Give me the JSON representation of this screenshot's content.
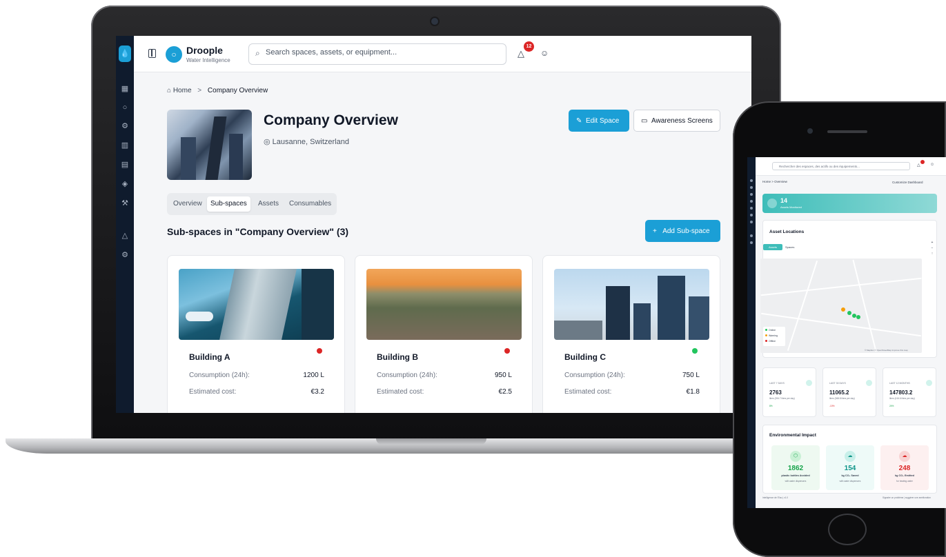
{
  "laptop": {
    "brand": {
      "name": "Droople",
      "tagline": "Water Intelligence"
    },
    "search_placeholder": "Search spaces, assets, or equipment...",
    "notification_count": "12",
    "rail_icons": [
      "droople-logo-icon",
      "dashboard-icon",
      "droplet-icon",
      "gear-icon",
      "map-icon",
      "building-icon",
      "package-icon",
      "wrench-icon",
      "bell-icon",
      "settings-icon"
    ],
    "breadcrumb": {
      "home": "Home",
      "separator": ">",
      "current": "Company Overview"
    },
    "page": {
      "title": "Company Overview",
      "location": "Lausanne, Switzerland"
    },
    "actions": {
      "edit": "Edit Space",
      "awareness": "Awareness Screens",
      "add": "Add Sub-space"
    },
    "tabs": [
      {
        "label": "Overview"
      },
      {
        "label": "Sub-spaces",
        "active": true
      },
      {
        "label": "Assets"
      },
      {
        "label": "Consumables"
      }
    ],
    "section_title": "Sub-spaces in \"Company Overview\" (3)",
    "cards": [
      {
        "name": "Building A",
        "status_color": "#dc2626",
        "consumption_label": "Consumption (24h):",
        "consumption": "1200 L",
        "cost_label": "Estimated cost:",
        "cost": "€3.2"
      },
      {
        "name": "Building B",
        "status_color": "#dc2626",
        "consumption_label": "Consumption (24h):",
        "consumption": "950 L",
        "cost_label": "Estimated cost:",
        "cost": "€2.5"
      },
      {
        "name": "Building C",
        "status_color": "#22c55e",
        "consumption_label": "Consumption (24h):",
        "consumption": "750 L",
        "cost_label": "Estimated cost:",
        "cost": "€1.8"
      }
    ],
    "colors": {
      "accent": "#1b9fd6",
      "rail": "#0f1b2d"
    }
  },
  "phone": {
    "search_placeholder": "Rechercher des espaces, des actifs ou des équipements...",
    "breadcrumb": "Home > Overview",
    "customize": "Customize Dashboard",
    "assets": {
      "count": "14",
      "label": "Assets Monitored"
    },
    "map": {
      "title": "Asset Locations",
      "toggle_assets": "Assets",
      "toggle_spaces": "Spaces",
      "legend": [
        "Online",
        "Warning",
        "Offline"
      ],
      "attribution": "© Mapbox © OpenStreetMap Improve this map"
    },
    "stats": [
      {
        "label": "LAST 7 DAYS",
        "value": "2763",
        "sub": "liters (394.7 liters per day)",
        "change": "8%"
      },
      {
        "label": "LAST 30 DAYS",
        "value": "11065.2",
        "sub": "liters (368.8 liters per day)",
        "change": "-10%"
      },
      {
        "label": "LAST 12 MONTHS",
        "value": "147803.2",
        "sub": "liters (416.6 liters per day)",
        "change": "24%"
      }
    ],
    "impact": {
      "title": "Environmental Impact",
      "items": [
        {
          "value": "1862",
          "label": "plastic bottles Avoided",
          "sub": "with water dispensers"
        },
        {
          "value": "154",
          "label": "kg CO₂ Saved",
          "sub": "with water dispensers"
        },
        {
          "value": "248",
          "label": "kg CO₂ Emitted",
          "sub": "for heating water"
        }
      ]
    },
    "footer_left": "Intelligence de l'Eau | v1.0",
    "footer_right": "Signaler un problème | suggérer une amélioration"
  }
}
